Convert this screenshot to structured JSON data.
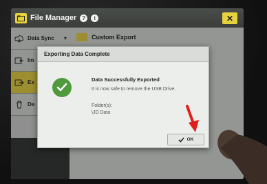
{
  "window": {
    "title": "File Manager",
    "close_label": "✕"
  },
  "sidebar": {
    "items": [
      {
        "label": "Data Sync",
        "icon": "cloud-sync-icon"
      },
      {
        "label": "Im",
        "icon": "import-icon"
      },
      {
        "label": "Ex",
        "icon": "export-icon",
        "active": true
      },
      {
        "label": "De",
        "icon": "trash-icon"
      }
    ]
  },
  "main": {
    "items": [
      {
        "label": "Custom Export",
        "icon": "folder-icon"
      }
    ]
  },
  "dialog": {
    "title": "Exporting Data Complete",
    "heading": "Data Successfully Exported",
    "body": "It is now safe to remove the USB Drive.",
    "folder_label": "Folder(s):",
    "folder_value": "\\JD Data",
    "ok_label": "OK"
  },
  "colors": {
    "accent": "#e6d13e",
    "success": "#4e9a3c",
    "pointer": "#e0201a"
  }
}
